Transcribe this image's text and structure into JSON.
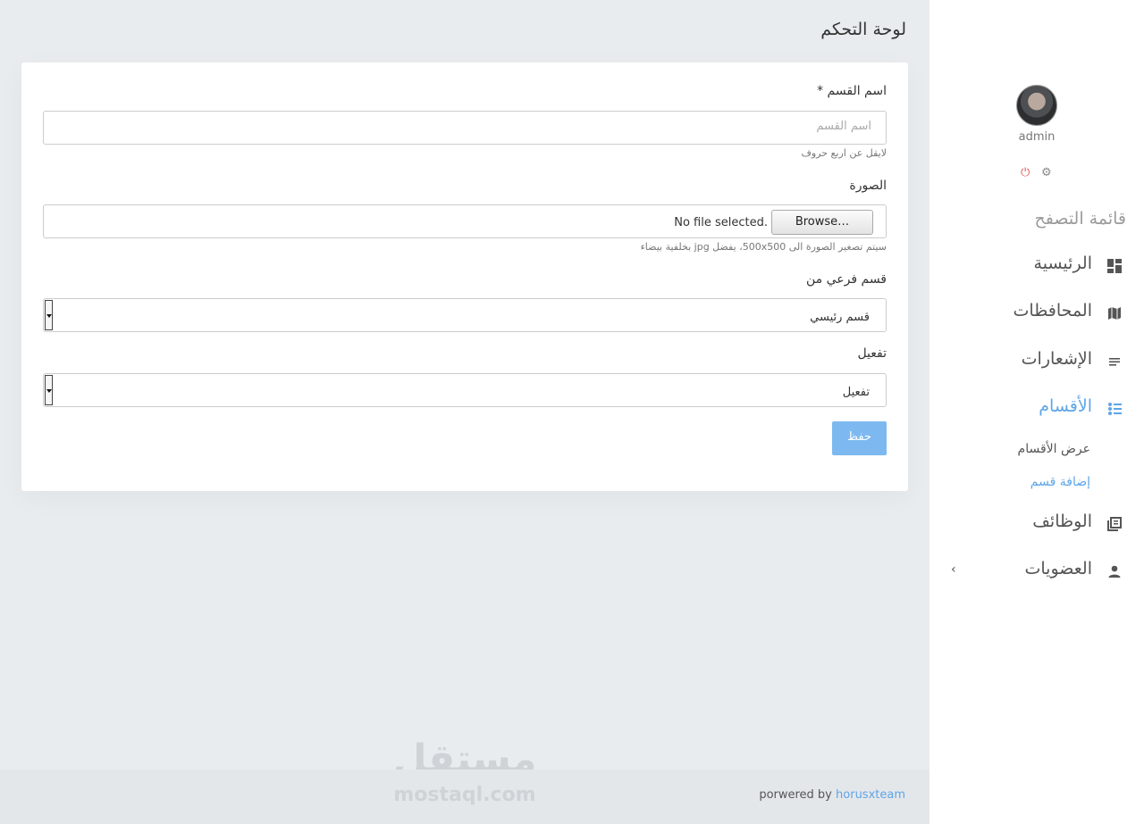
{
  "page": {
    "title": "لوحة التحكم"
  },
  "user": {
    "name": "admin"
  },
  "sidebar": {
    "header": "قائمة التصفح",
    "items": [
      {
        "label": "الرئيسية",
        "icon": "dashboard-icon"
      },
      {
        "label": "المحافظات",
        "icon": "map-icon"
      },
      {
        "label": "الإشعارات",
        "icon": "notes-icon"
      },
      {
        "label": "الأقسام",
        "icon": "list-icon",
        "active": true,
        "sub": [
          {
            "label": "عرض الأقسام"
          },
          {
            "label": "إضافة قسم",
            "active": true
          }
        ]
      },
      {
        "label": "الوظائف",
        "icon": "library-icon"
      },
      {
        "label": "العضويات",
        "icon": "person-icon",
        "chevron": "›"
      }
    ]
  },
  "form": {
    "name": {
      "label": "اسم القسم *",
      "placeholder": "اسم القسم",
      "help": "لايقل عن اربع حروف"
    },
    "image": {
      "label": "الصورة",
      "button": "Browse…",
      "status": "No file selected.",
      "help": "سيتم تصغير الصورة الى 500x500، يفضل jpg بخلفية بيضاء"
    },
    "parent": {
      "label": "قسم فرعي من",
      "value": "قسم رئيسي"
    },
    "active": {
      "label": "تفعيل",
      "value": "تفعيل"
    },
    "save": "حفظ"
  },
  "footer": {
    "text": "porwered by",
    "link": "horusxteam"
  },
  "watermark": {
    "ar": "مستقل",
    "en": "mostaql.com"
  },
  "colors": {
    "accent": "#5ea5e8",
    "button": "#7db9f0",
    "power": "#e55353"
  }
}
